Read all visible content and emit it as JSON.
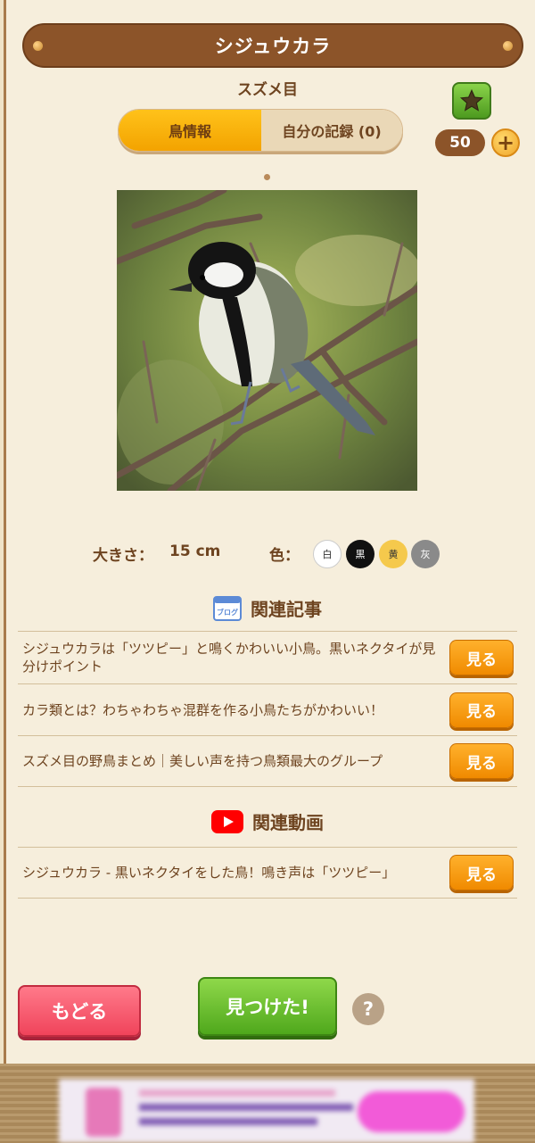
{
  "header": {
    "title": "シジュウカラ",
    "order": "スズメ目"
  },
  "tabs": [
    {
      "label": "鳥情報",
      "active": true
    },
    {
      "label": "自分の記録 (0)",
      "active": false
    }
  ],
  "coins": {
    "count": "50",
    "plus_label": "+"
  },
  "details": {
    "size_label": "大きさ：",
    "size_value": "15 cm",
    "color_label": "色：",
    "colors": [
      {
        "label": "白",
        "hex": "#ffffff"
      },
      {
        "label": "黒",
        "hex": "#111111"
      },
      {
        "label": "黄",
        "hex": "#f5c94c"
      },
      {
        "label": "灰",
        "hex": "#8a8a8a"
      }
    ]
  },
  "articles": {
    "heading": "関連記事",
    "icon_text": "ブログ",
    "items": [
      {
        "title": "シジュウカラは「ツツピー」と鳴くかわいい小鳥。黒いネクタイが見分けポイント",
        "button": "見る"
      },
      {
        "title": "カラ類とは？わちゃわちゃ混群を作る小鳥たちがかわいい！",
        "button": "見る"
      },
      {
        "title": "スズメ目の野鳥まとめ｜美しい声を持つ鳥類最大のグループ",
        "button": "見る"
      }
    ]
  },
  "videos": {
    "heading": "関連動画",
    "items": [
      {
        "title": "シジュウカラ - 黒いネクタイをした鳥！鳴き声は「ツツピー」",
        "button": "見る"
      }
    ]
  },
  "footer": {
    "back_label": "もどる",
    "found_label": "見つけた!",
    "help_label": "?"
  },
  "colors": {
    "title_bar": "#8c5429",
    "tab_active": "#ffc21a",
    "see_button": "#f08a00",
    "back_button": "#f0445b",
    "found_button": "#4fa81c"
  }
}
